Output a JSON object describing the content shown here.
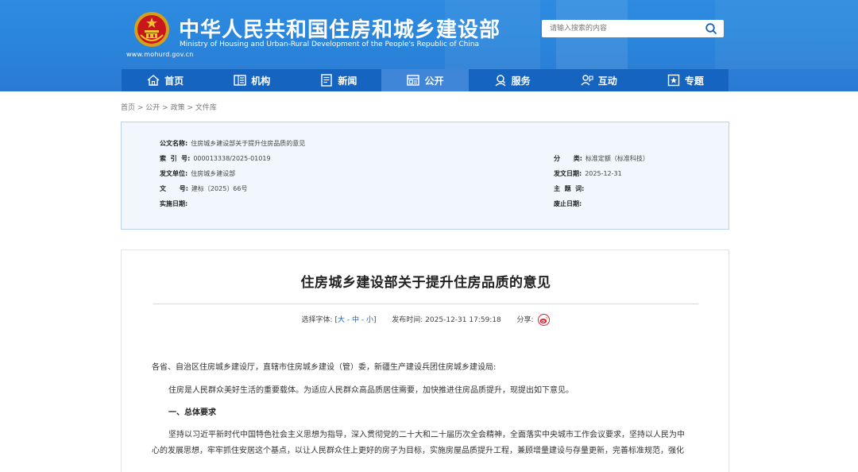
{
  "header": {
    "title": "中华人民共和国住房和城乡建设部",
    "subtitle": "Ministry of Housing and Urban-Rural Development of the People's Republic of China",
    "url": "www.mohurd.gov.cn",
    "emblem_icon": "national-emblem-icon",
    "brand_color": "#2a86dc"
  },
  "search": {
    "placeholder": "请输入搜索的内容",
    "icon": "search-icon"
  },
  "nav": {
    "items": [
      {
        "label": "首页",
        "icon": "home-icon"
      },
      {
        "label": "机构",
        "icon": "building-icon"
      },
      {
        "label": "新闻",
        "icon": "news-icon"
      },
      {
        "label": "公开",
        "icon": "disclosure-icon"
      },
      {
        "label": "服务",
        "icon": "service-icon"
      },
      {
        "label": "互动",
        "icon": "interact-icon"
      },
      {
        "label": "专题",
        "icon": "topic-icon"
      }
    ],
    "active": "公开"
  },
  "breadcrumb": {
    "items": [
      "首页",
      "公开",
      "政策",
      "文件库"
    ],
    "separator": " > "
  },
  "info": {
    "doc_name_label": "公文名称:",
    "doc_name": "住房城乡建设部关于提升住房品质的意见",
    "index_label": "索  引  号:",
    "index": "000013338/2025-01019",
    "issuer_label": "发文单位:",
    "issuer": "住房城乡建设部",
    "doc_no_label": "文      号:",
    "doc_no": "建标〔2025〕66号",
    "effective_label": "实施日期:",
    "effective": "",
    "category_label": "分      类:",
    "category": "标准定额（标准科技）",
    "issue_date_label": "发文日期:",
    "issue_date": "2025-12-31",
    "keywords_label": "主  题  词:",
    "keywords": "",
    "expire_label": "废止日期:",
    "expire": ""
  },
  "article": {
    "title": "住房城乡建设部关于提升住房品质的意见",
    "font_size_label": "选择字体:",
    "font_sizes": [
      "大",
      "中",
      "小"
    ],
    "publish_label": "发布时间:",
    "publish_time": "2025-12-31 17:59:18",
    "share_label": "分享:",
    "share_icon": "weibo-icon",
    "paragraphs": [
      "各省、自治区住房城乡建设厅，直辖市住房城乡建设（管）委，新疆生产建设兵团住房城乡建设局:",
      "住房是人民群众美好生活的重要载体。为适应人民群众高品质居住需要，加快推进住房品质提升，现提出如下意见。",
      "一、总体要求",
      "坚持以习近平新时代中国特色社会主义思想为指导，深入贯彻党的二十大和二十届历次全会精神，全面落实中央城市工作会议要求，坚持以人民为中",
      "心的发展思想，牢牢抓住安居这个基点，以让人民群众住上更好的房子为目标，实施房屋品质提升工程，兼顾增量建设与存量更新，完善标准规范，强化"
    ]
  }
}
